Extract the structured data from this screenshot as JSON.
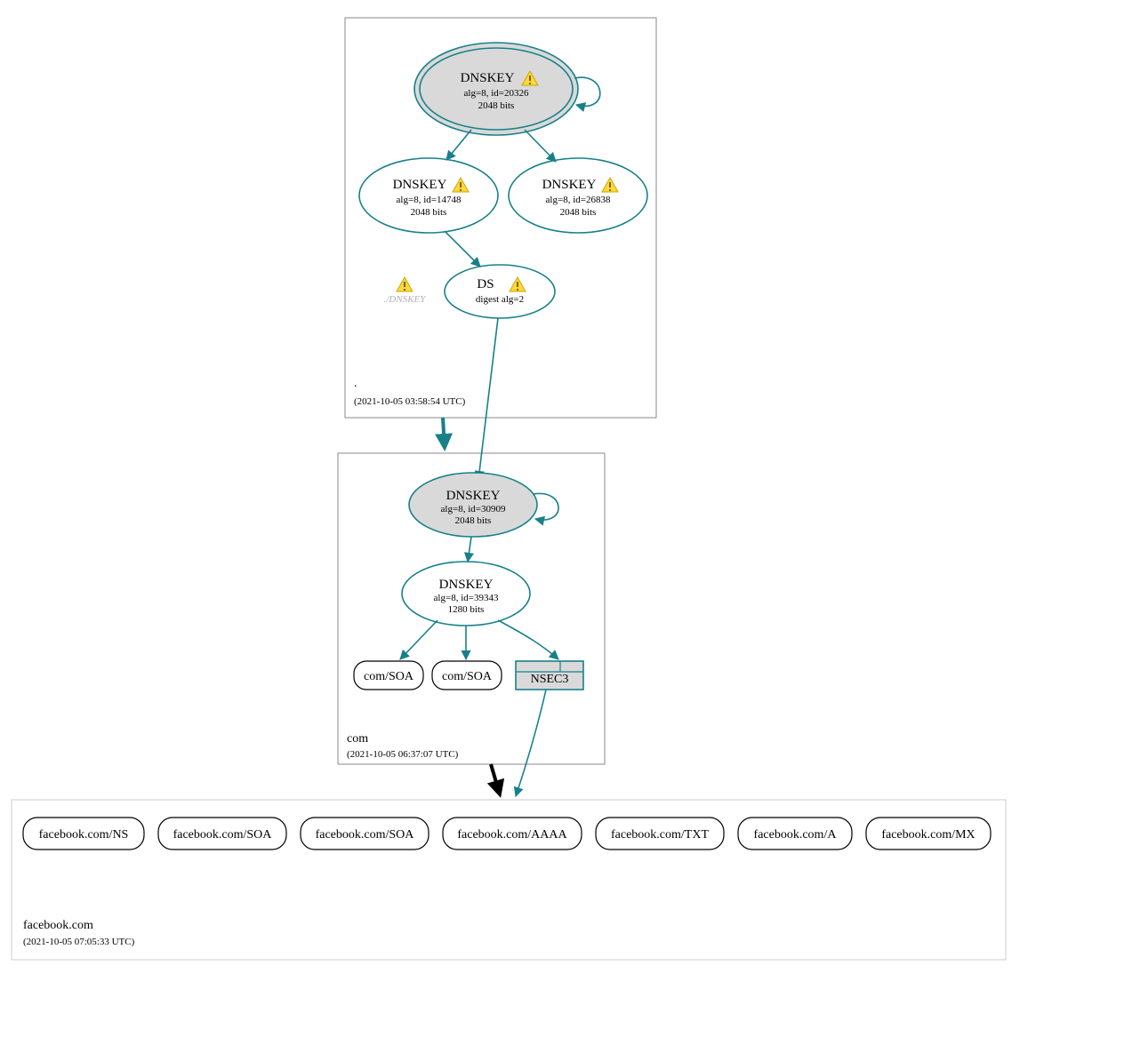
{
  "zones": {
    "root": {
      "name": ".",
      "timestamp": "(2021-10-05 03:58:54 UTC)"
    },
    "com": {
      "name": "com",
      "timestamp": "(2021-10-05 06:37:07 UTC)"
    },
    "fb": {
      "name": "facebook.com",
      "timestamp": "(2021-10-05 07:05:33 UTC)"
    }
  },
  "root": {
    "ksk": {
      "title": "DNSKEY",
      "sub1": "alg=8, id=20326",
      "sub2": "2048 bits",
      "warn": true
    },
    "zsk1": {
      "title": "DNSKEY",
      "sub1": "alg=8, id=14748",
      "sub2": "2048 bits",
      "warn": true
    },
    "zsk2": {
      "title": "DNSKEY",
      "sub1": "alg=8, id=26838",
      "sub2": "2048 bits",
      "warn": true
    },
    "ds": {
      "title": "DS",
      "sub1": "digest alg=2",
      "warn": true
    },
    "ghost": {
      "label": "./DNSKEY"
    }
  },
  "com": {
    "ksk": {
      "title": "DNSKEY",
      "sub1": "alg=8, id=30909",
      "sub2": "2048 bits"
    },
    "zsk": {
      "title": "DNSKEY",
      "sub1": "alg=8, id=39343",
      "sub2": "1280 bits"
    },
    "soa1": "com/SOA",
    "soa2": "com/SOA",
    "nsec": "NSEC3"
  },
  "records": {
    "ns": "facebook.com/NS",
    "soa1": "facebook.com/SOA",
    "soa2": "facebook.com/SOA",
    "aaaa": "facebook.com/AAAA",
    "txt": "facebook.com/TXT",
    "a": "facebook.com/A",
    "mx": "facebook.com/MX"
  },
  "icons": {
    "warn": "⚠"
  }
}
